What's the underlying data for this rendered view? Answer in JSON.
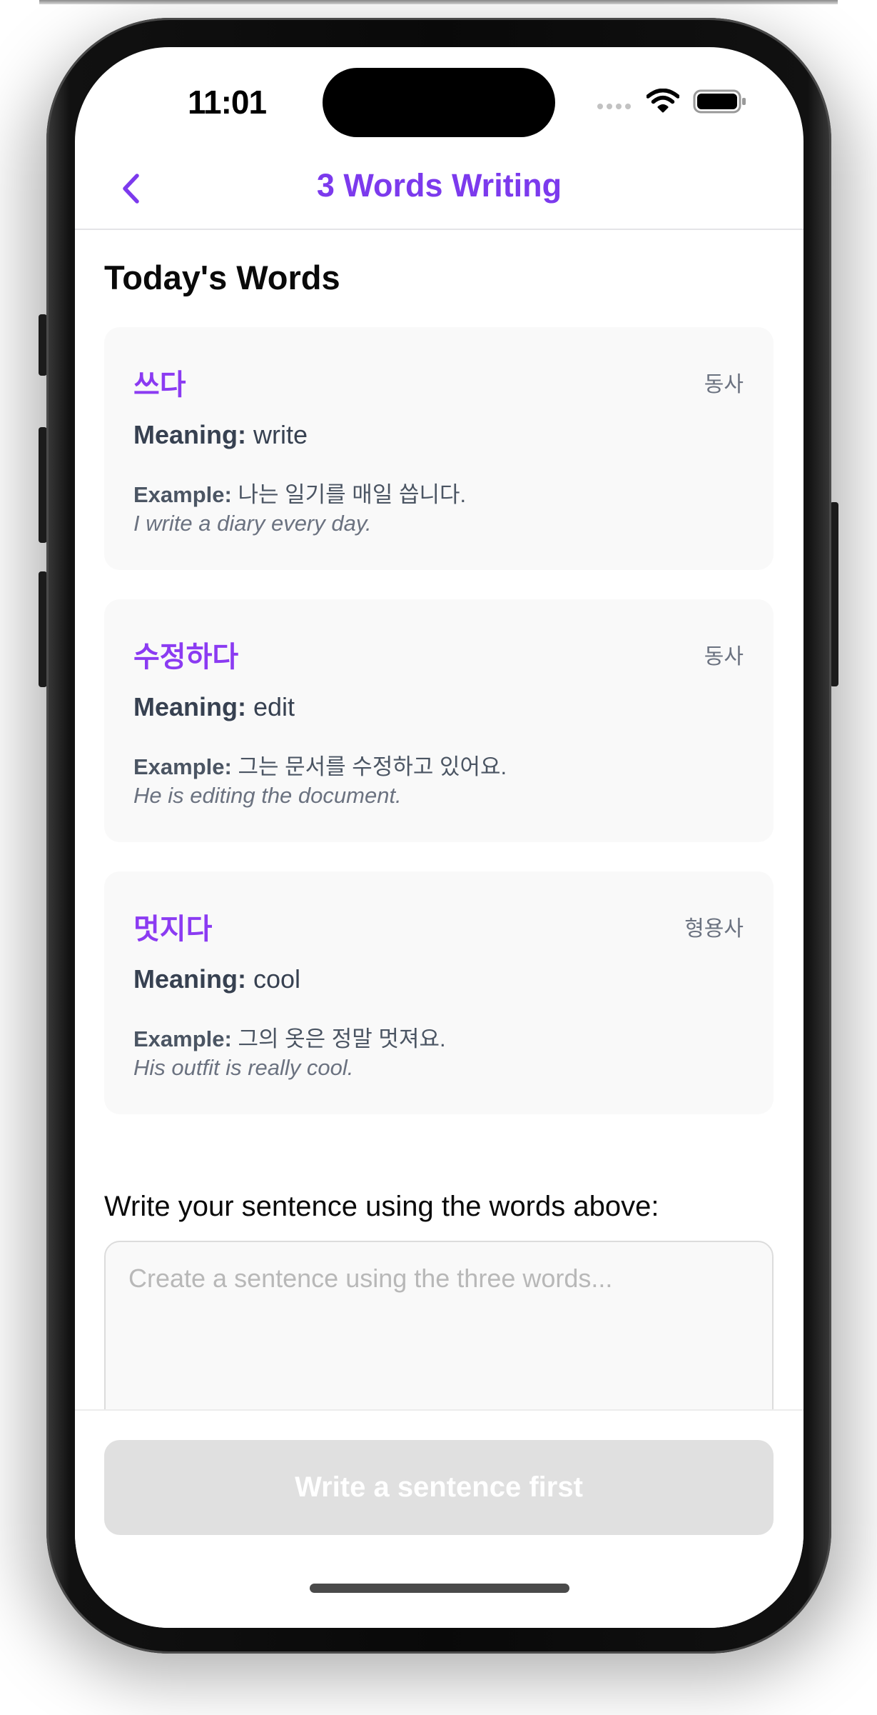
{
  "status_bar": {
    "time": "11:01"
  },
  "nav": {
    "title": "3 Words Writing"
  },
  "section_title": "Today's Words",
  "words": [
    {
      "term": "쓰다",
      "pos": "동사",
      "meaning_label": "Meaning:",
      "meaning": "write",
      "example_label": "Example:",
      "example": "나는 일기를 매일 씁니다.",
      "translation": "I write a diary every day."
    },
    {
      "term": "수정하다",
      "pos": "동사",
      "meaning_label": "Meaning:",
      "meaning": "edit",
      "example_label": "Example:",
      "example": "그는 문서를 수정하고 있어요.",
      "translation": "He is editing the document."
    },
    {
      "term": "멋지다",
      "pos": "형용사",
      "meaning_label": "Meaning:",
      "meaning": "cool",
      "example_label": "Example:",
      "example": "그의 옷은 정말 멋져요.",
      "translation": "His outfit is really cool."
    }
  ],
  "composer": {
    "label": "Write your sentence using the words above:",
    "value": "",
    "placeholder": "Create a sentence using the three words..."
  },
  "submit": {
    "label": "Write a sentence first",
    "enabled": false
  },
  "colors": {
    "accent": "#7c3aed",
    "term": "#8b3bf2",
    "card_bg": "#f9f9f9",
    "disabled_button": "#e0e0e0"
  },
  "icons": {
    "back": "chevron-left-icon",
    "wifi": "wifi-icon",
    "battery": "battery-icon",
    "signal": "cellular-signal-icon"
  }
}
